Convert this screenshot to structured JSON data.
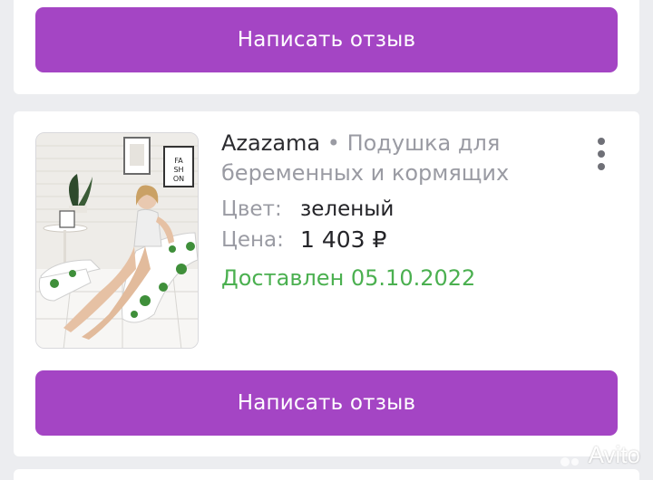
{
  "top_card": {
    "review_button": "Написать отзыв"
  },
  "order": {
    "seller": "Azazama",
    "separator": "•",
    "product_line1": "Подушка для",
    "product_line2": "беременных и кормящих",
    "color_label": "Цвет:",
    "color_value": "зеленый",
    "price_label": "Цена:",
    "price_value": "1 403 ₽",
    "status": "Доставлен 05.10.2022",
    "review_button": "Написать отзыв",
    "image_alt": "woman-with-pregnancy-pillow-photo"
  },
  "watermark": {
    "text": "Avito",
    "icon": "avito-logo-icon"
  },
  "colors": {
    "accent": "#a445c4",
    "status_green": "#4bb050",
    "muted": "#9a9ba3",
    "background": "#ecedf0"
  }
}
